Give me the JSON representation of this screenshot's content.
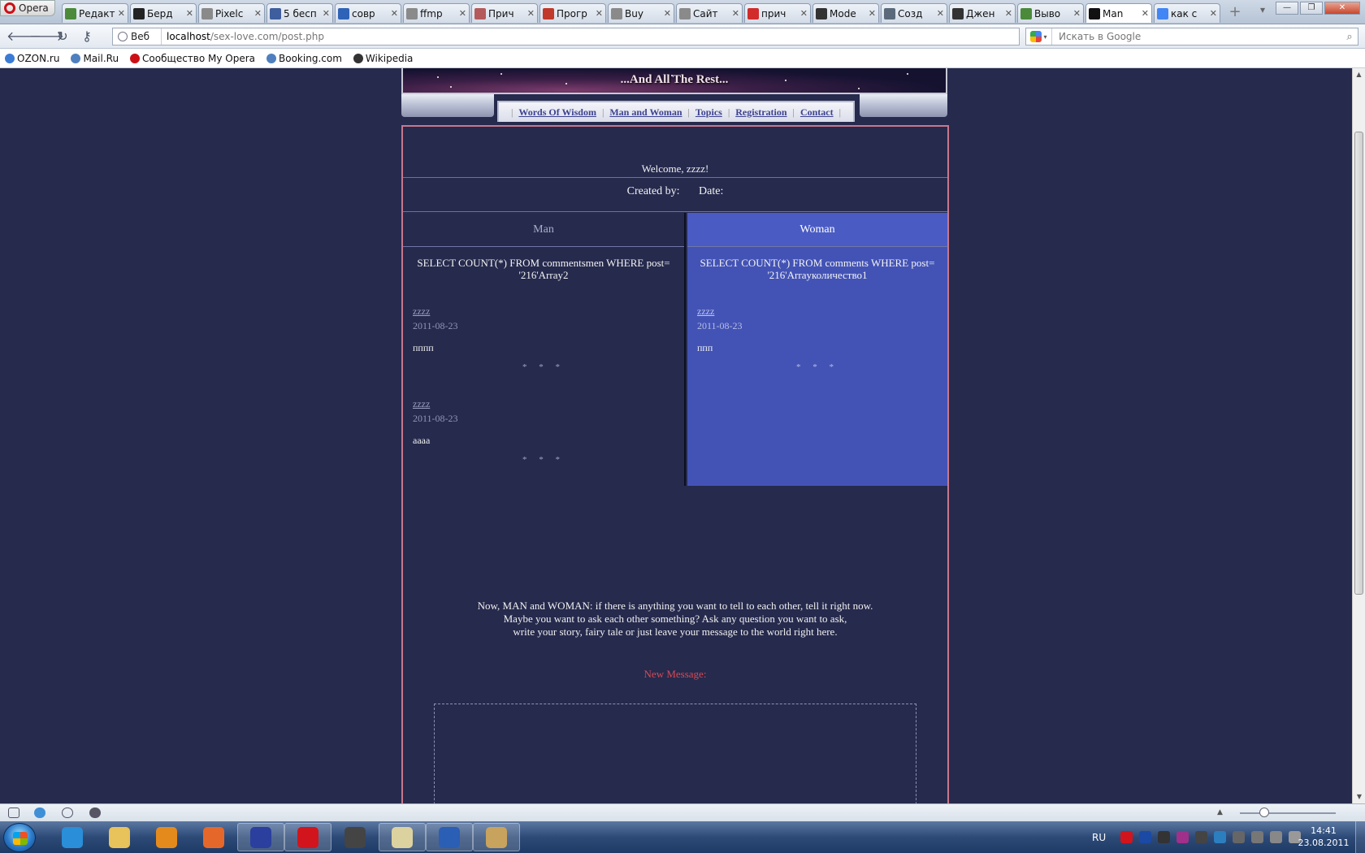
{
  "browser": {
    "menu_label": "Opera",
    "tabs": [
      {
        "label": "Редакт",
        "icon": "chart-icon",
        "color": "#4a8a3a"
      },
      {
        "label": "Берд",
        "icon": "z-icon",
        "color": "#222222"
      },
      {
        "label": "Pixelc",
        "icon": "page-icon",
        "color": "#8a8a8a"
      },
      {
        "label": "5 бесп",
        "icon": "p-icon",
        "color": "#3e5e9e"
      },
      {
        "label": "совр",
        "icon": "sql-icon",
        "color": "#2f63b7"
      },
      {
        "label": "ffmp",
        "icon": "page-icon",
        "color": "#8a8a8a"
      },
      {
        "label": "Прич",
        "icon": "eye-icon",
        "color": "#b45a5a"
      },
      {
        "label": "Прогр",
        "icon": "elib-icon",
        "color": "#c0392b"
      },
      {
        "label": "Buy",
        "icon": "page-icon",
        "color": "#8a8a8a"
      },
      {
        "label": "Сайт",
        "icon": "page-icon",
        "color": "#8a8a8a"
      },
      {
        "label": "прич",
        "icon": "youtube-icon",
        "color": "#d12b2b"
      },
      {
        "label": "Mode",
        "icon": "wikipedia-icon",
        "color": "#333333"
      },
      {
        "label": "Созд",
        "icon": "h-icon",
        "color": "#5a6a7a"
      },
      {
        "label": "Джен",
        "icon": "wikipedia-icon",
        "color": "#333333"
      },
      {
        "label": "Выво",
        "icon": "chart-icon",
        "color": "#4a8a3a"
      },
      {
        "label": "Man",
        "icon": "spy-icon",
        "color": "#111111",
        "active": true
      },
      {
        "label": "как с",
        "icon": "google-icon",
        "color": "#4285f4"
      }
    ],
    "close_glyph": "✕",
    "address": {
      "scheme_label": "Веб",
      "host": "localhost",
      "path": "/sex-love.com/post.php"
    },
    "search_placeholder": "Искать в Google",
    "bookmarks": [
      {
        "label": "OZON.ru",
        "color": "#3b7bd6"
      },
      {
        "label": "Mail.Ru",
        "color": "#4f7fbf"
      },
      {
        "label": "Сообщество My Opera",
        "color": "#cc0f16"
      },
      {
        "label": "Booking.com",
        "color": "#4f7fbf"
      },
      {
        "label": "Wikipedia",
        "color": "#333333"
      }
    ]
  },
  "site": {
    "banner_title": "...And All The Rest...",
    "nav": [
      "Words Of Wisdom",
      "Man and Woman",
      "Topics",
      "Registration",
      "Contact"
    ],
    "welcome": "Welcome,  zzzz!",
    "created_by_label": "Created by:",
    "date_label": "Date:",
    "man": {
      "heading": "Man",
      "query": "SELECT COUNT(*) FROM commentsmen WHERE post= '216'Array2",
      "posts": [
        {
          "author": "zzzz",
          "date": "2011-08-23",
          "text": "пппп",
          "separator": "* * *"
        },
        {
          "author": "zzzz",
          "date": "2011-08-23",
          "text": "aaaa",
          "separator": "* * *"
        }
      ]
    },
    "woman": {
      "heading": "Woman",
      "query": "SELECT COUNT(*) FROM comments  WHERE post= '216'Arrayколичество1",
      "posts": [
        {
          "author": "zzzz",
          "date": "2011-08-23",
          "text": "ппп",
          "separator": "* * *"
        }
      ]
    },
    "intro_lines": [
      "Now, MAN and WOMAN: if there is anything you want to tell to each other, tell it right now.",
      "Maybe you want to ask each other something? Ask any question you want to ask,",
      "write your story, fairy tale or just leave your message to the world right here."
    ],
    "new_message_label": "New Message:"
  },
  "taskbar": {
    "apps": [
      {
        "name": "internet-explorer-icon",
        "color": "#2a8ed8",
        "open": false
      },
      {
        "name": "folder-icon",
        "color": "#e8c25a",
        "open": false
      },
      {
        "name": "media-player-icon",
        "color": "#e48a1c",
        "open": false
      },
      {
        "name": "firefox-icon",
        "color": "#e5682a",
        "open": false
      },
      {
        "name": "save-disk-icon",
        "color": "#2a3f9e",
        "open": true
      },
      {
        "name": "opera-icon",
        "color": "#d2151c",
        "open": true
      },
      {
        "name": "media-classic-icon",
        "color": "#444444",
        "open": false
      },
      {
        "name": "notepad-icon",
        "color": "#dcd2a0",
        "open": true
      },
      {
        "name": "word-icon",
        "color": "#2b5eb5",
        "open": true
      },
      {
        "name": "paint-icon",
        "color": "#c7a35d",
        "open": true
      }
    ],
    "language": "RU",
    "tray_colors": [
      "#d2151c",
      "#1b4aa5",
      "#333333",
      "#a0308a",
      "#444444",
      "#2c7fbf",
      "#666666",
      "#777777",
      "#888888",
      "#999999"
    ],
    "time": "14:41",
    "date": "23.08.2011"
  }
}
